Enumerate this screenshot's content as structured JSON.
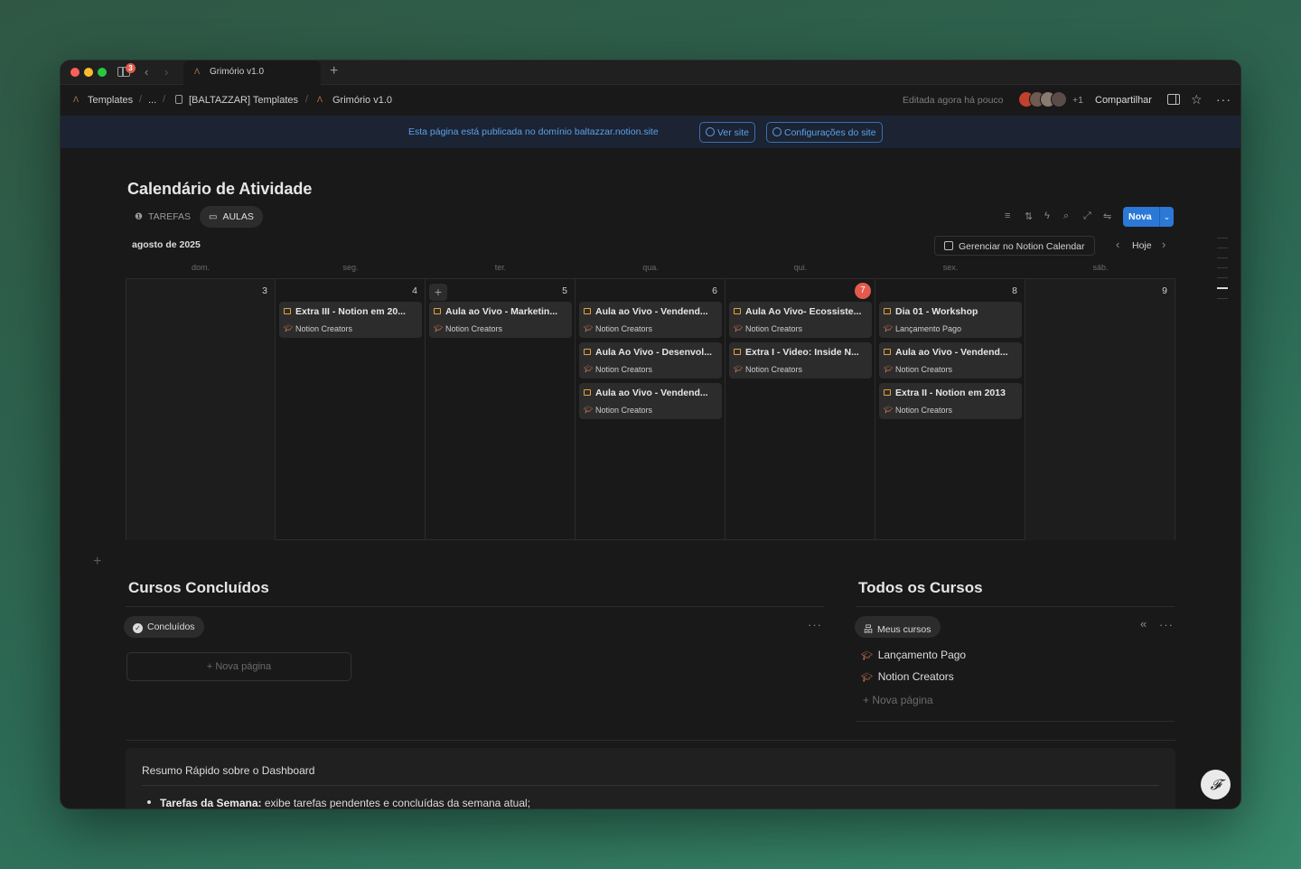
{
  "titlebar": {
    "notif_count": "3",
    "tab_title": "Grimório v1.0",
    "new_tab": "+"
  },
  "breadcrumb": {
    "items": [
      "Templates",
      "...",
      "[BALTAZZAR] Templates",
      "Grimório v1.0"
    ],
    "separator": "/",
    "edited": "Editada agora há pouco",
    "plus_more": "+1",
    "share": "Compartilhar"
  },
  "banner": {
    "text": "Esta página está publicada no domínio baltazzar.notion.site",
    "view_site": "Ver site",
    "site_settings": "Configurações do site"
  },
  "page": {
    "title": "Calendário de Atividade",
    "views": [
      "TAREFAS",
      "AULAS"
    ],
    "new_button": "Nova",
    "month": "agosto de 2025",
    "manage_calendar": "Gerenciar no Notion Calendar",
    "today": "Hoje"
  },
  "calendar": {
    "weekdays": [
      "dom.",
      "seg.",
      "ter.",
      "qua.",
      "qui.",
      "sex.",
      "sáb."
    ],
    "days": [
      {
        "num": "3",
        "events": []
      },
      {
        "num": "4",
        "events": [
          {
            "title": "Extra III - Notion em 20...",
            "sub": "Notion Creators"
          }
        ]
      },
      {
        "num": "5",
        "events": [
          {
            "title": "Aula ao Vivo - Marketin...",
            "sub": "Notion Creators"
          }
        ]
      },
      {
        "num": "6",
        "events": [
          {
            "title": "Aula ao Vivo - Vendend...",
            "sub": "Notion Creators"
          },
          {
            "title": "Aula Ao Vivo - Desenvol...",
            "sub": "Notion Creators"
          },
          {
            "title": "Aula ao Vivo - Vendend...",
            "sub": "Notion Creators"
          }
        ]
      },
      {
        "num": "7",
        "today": true,
        "events": [
          {
            "title": "Aula Ao Vivo- Ecossiste...",
            "sub": "Notion Creators"
          },
          {
            "title": "Extra I - Video: Inside N...",
            "sub": "Notion Creators"
          }
        ]
      },
      {
        "num": "8",
        "events": [
          {
            "title": "Dia 01 - Workshop",
            "sub": "Lançamento Pago"
          },
          {
            "title": "Aula ao Vivo - Vendend...",
            "sub": "Notion Creators"
          },
          {
            "title": "Extra II - Notion em 2013",
            "sub": "Notion Creators"
          }
        ]
      },
      {
        "num": "9",
        "events": []
      }
    ]
  },
  "completed": {
    "title": "Cursos Concluídos",
    "chip": "Concluídos",
    "more": "···",
    "new_page": "+ Nova página"
  },
  "all_courses": {
    "title": "Todos os Cursos",
    "chip": "Meus cursos",
    "more": "···",
    "collapse": "«",
    "items": [
      "Lançamento Pago",
      "Notion Creators"
    ],
    "new_page": "+ Nova página"
  },
  "summary": {
    "title": "Resumo Rápido sobre o Dashboard",
    "bullet_label": "Tarefas da Semana:",
    "bullet_text": " exibe tarefas pendentes e concluídas da semana atual;"
  },
  "colors": {
    "accent_blue": "#2b78d6",
    "today_red": "#e35b4d",
    "event_icon": "#e8a23b"
  }
}
